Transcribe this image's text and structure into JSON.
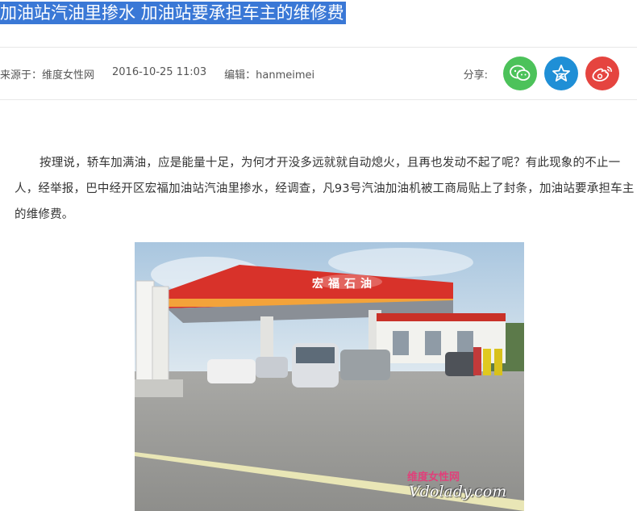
{
  "article": {
    "title": "加油站汽油里掺水  加油站要承担车主的维修费",
    "meta": {
      "source": "来源于：维度女性网",
      "datetime": "2016-10-25 11:03",
      "editor": "编辑：hanmeimei"
    },
    "share": {
      "label": "分享:",
      "buttons": [
        {
          "name": "wechat",
          "icon": "wechat-icon",
          "color": "#4cc25a"
        },
        {
          "name": "qzone",
          "icon": "qzone-star-icon",
          "color": "#1f8fd6"
        },
        {
          "name": "weibo",
          "icon": "weibo-icon",
          "color": "#e5443f"
        }
      ]
    },
    "body": "按理说，轿车加满油，应是能量十足，为何才开没多远就就自动熄火，且再也发动不起了呢？有此现象的不止一人，经举报，巴中经开区宏福加油站汽油里掺水，经调查，凡93号汽油加油机被工商局贴上了封条，加油站要承担车主的维修费。",
    "photo": {
      "station_sign": "宏福石油",
      "watermark_cn": "维度女性网",
      "watermark_en": "Vdolady.com"
    }
  },
  "colors": {
    "title_highlight": "#3a78d6",
    "canopy_red": "#d8322a",
    "sky": "#bcd3e6"
  }
}
